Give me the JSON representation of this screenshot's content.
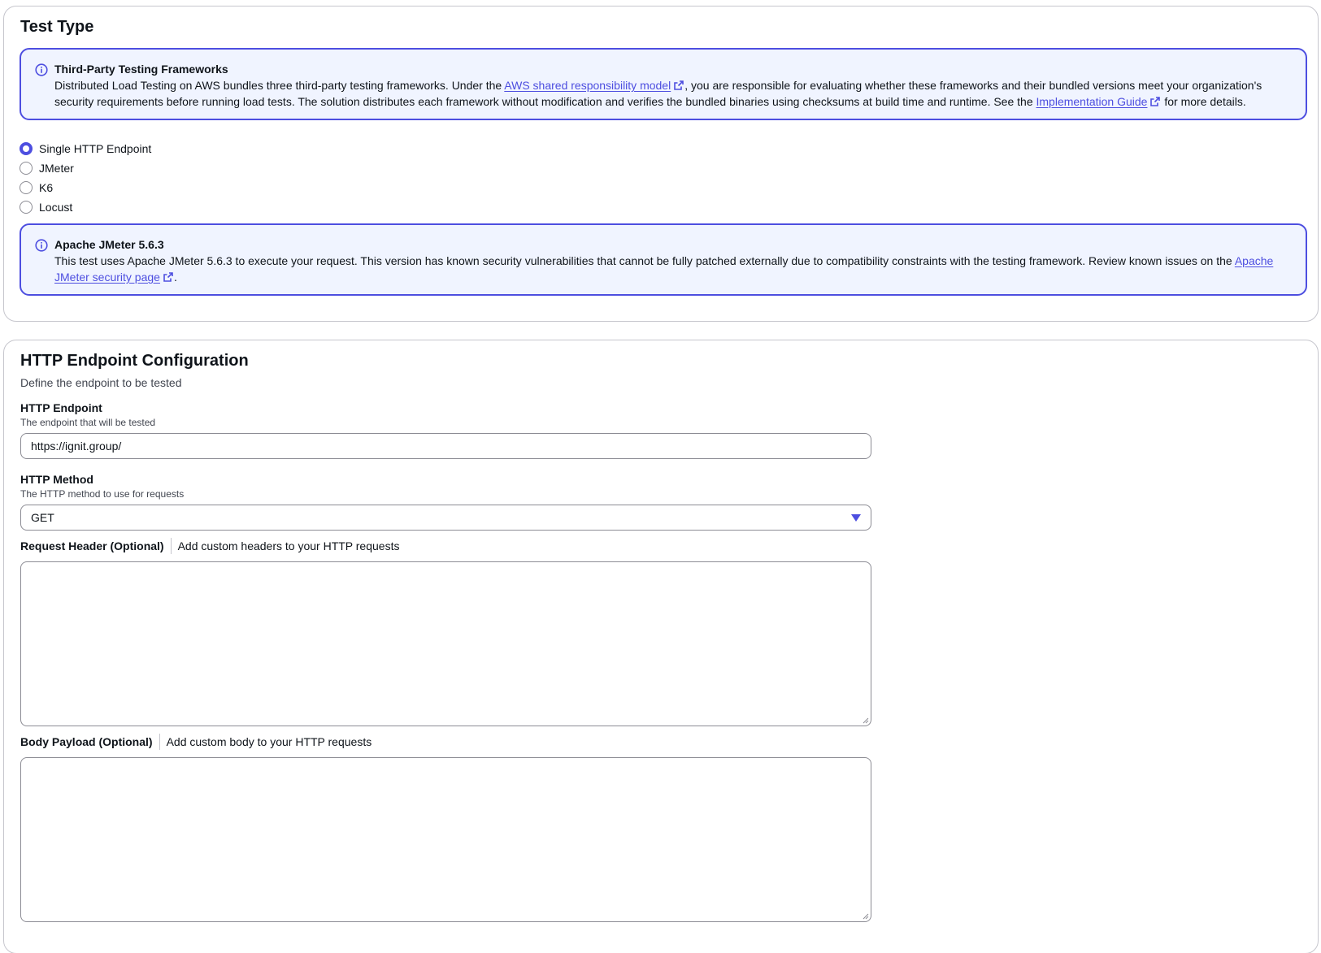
{
  "test_type": {
    "title": "Test Type",
    "framework_alert": {
      "icon": "info-icon",
      "title": "Third-Party Testing Frameworks",
      "text_1": "Distributed Load Testing on AWS bundles three third-party testing frameworks. Under the ",
      "link_1": "AWS shared responsibility model",
      "text_2": ", you are responsible for evaluating whether these frameworks and their bundled versions meet your organization's security requirements before running load tests. The solution distributes each framework without modification and verifies the bundled binaries using checksums at build time and runtime. See the ",
      "link_2": "Implementation Guide",
      "text_3": " for more details."
    },
    "options": [
      {
        "label": "Single HTTP Endpoint",
        "checked": true
      },
      {
        "label": "JMeter",
        "checked": false
      },
      {
        "label": "K6",
        "checked": false
      },
      {
        "label": "Locust",
        "checked": false
      }
    ],
    "jmeter_alert": {
      "icon": "info-icon",
      "title": "Apache JMeter 5.6.3",
      "text_1": "This test uses Apache JMeter 5.6.3 to execute your request. This version has known security vulnerabilities that cannot be fully patched externally due to compatibility constraints with the testing framework. Review known issues on the ",
      "link_1": "Apache JMeter security page",
      "text_2": "."
    }
  },
  "http_config": {
    "title": "HTTP Endpoint Configuration",
    "subtitle": "Define the endpoint to be tested",
    "endpoint": {
      "label": "HTTP Endpoint",
      "description": "The endpoint that will be tested",
      "value": "https://ignit.group/"
    },
    "method": {
      "label": "HTTP Method",
      "description": "The HTTP method to use for requests",
      "value": "GET"
    },
    "request_header": {
      "label": "Request Header (Optional)",
      "description": "Add custom headers to your HTTP requests",
      "value": ""
    },
    "body_payload": {
      "label": "Body Payload (Optional)",
      "description": "Add custom body to your HTTP requests",
      "value": ""
    }
  },
  "colors": {
    "accent": "#4d4ee0",
    "alert_background": "#f0f4ff",
    "border": "#8c8c94"
  }
}
